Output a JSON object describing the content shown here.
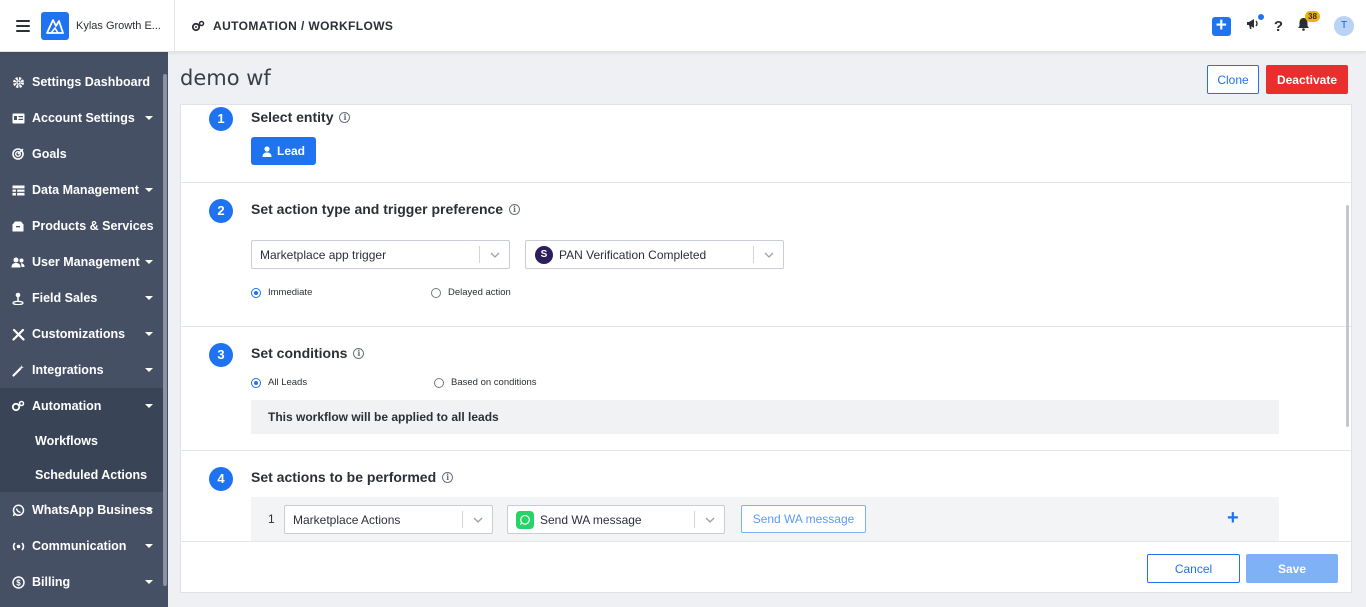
{
  "topbar": {
    "brand": "Kylas Growth E...",
    "breadcrumb": "AUTOMATION / WORKFLOWS",
    "notification_count": "38",
    "avatar_initial": "T"
  },
  "sidebar": {
    "items": [
      {
        "label": "Settings Dashboard",
        "icon": "gear-icon"
      },
      {
        "label": "Account Settings",
        "icon": "id-card-icon"
      },
      {
        "label": "Goals",
        "icon": "target-icon"
      },
      {
        "label": "Data Management",
        "icon": "table-icon"
      },
      {
        "label": "Products & Services",
        "icon": "box-icon"
      },
      {
        "label": "User Management",
        "icon": "users-icon"
      },
      {
        "label": "Field Sales",
        "icon": "map-pin-icon"
      },
      {
        "label": "Customizations",
        "icon": "tools-icon"
      },
      {
        "label": "Integrations",
        "icon": "wand-icon"
      },
      {
        "label": "Automation",
        "icon": "gears-icon"
      },
      {
        "label": "WhatsApp Business",
        "icon": "whatsapp-icon"
      },
      {
        "label": "Communication",
        "icon": "broadcast-icon"
      },
      {
        "label": "Billing",
        "icon": "dollar-icon"
      }
    ],
    "sub_items": [
      {
        "label": "Workflows"
      },
      {
        "label": "Scheduled Actions"
      }
    ]
  },
  "page": {
    "title": "demo wf",
    "clone_label": "Clone",
    "deactivate_label": "Deactivate"
  },
  "steps": {
    "s1": {
      "number": "1",
      "title": "Select entity",
      "entity_button": "Lead"
    },
    "s2": {
      "number": "2",
      "title": "Set action type and trigger preference",
      "action_type": "Marketplace app trigger",
      "trigger_app_initial": "S",
      "trigger": "PAN Verification Completed",
      "radio_immediate": "Immediate",
      "radio_delayed": "Delayed action",
      "selected": "Immediate"
    },
    "s3": {
      "number": "3",
      "title": "Set conditions",
      "radio_all": "All Leads",
      "radio_based": "Based on conditions",
      "selected": "All Leads",
      "note": "This workflow will be applied to all leads"
    },
    "s4": {
      "number": "4",
      "title": "Set actions to be performed",
      "row": {
        "index": "1",
        "action_category": "Marketplace Actions",
        "action": "Send WA message",
        "button": "Send WA message"
      }
    }
  },
  "footer": {
    "cancel_label": "Cancel",
    "save_label": "Save"
  },
  "colors": {
    "primary": "#1f73f1",
    "danger": "#ea2e2e",
    "sidebar_bg": "#455065",
    "badge": "#f2b10d",
    "whatsapp": "#25d366"
  }
}
